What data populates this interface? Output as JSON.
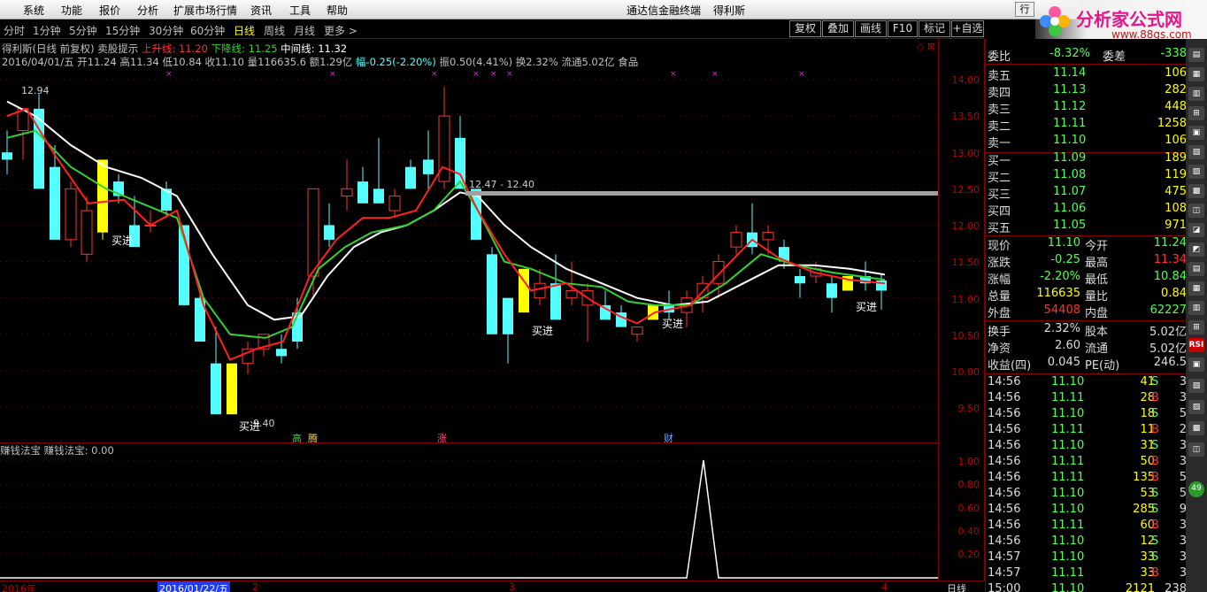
{
  "menu": [
    "系统",
    "功能",
    "报价",
    "分析",
    "扩展市场行情",
    "资讯",
    "工具",
    "帮助"
  ],
  "app_title": "通达信金融终端",
  "stock_name_title": "得利斯",
  "logo": {
    "text": "分析家公式网",
    "url_text": "www.88gs.com"
  },
  "periods": [
    "分时",
    "1分钟",
    "5分钟",
    "15分钟",
    "30分钟",
    "60分钟",
    "日线",
    "周线",
    "月线",
    "更多 >"
  ],
  "active_period": "日线",
  "toolbar_buttons": [
    "复权",
    "叠加",
    "画线",
    "F10",
    "+自选"
  ],
  "chart_header": {
    "title": "得利斯(日线 前复权) 卖股提示",
    "up_line": "上升线: 11.20",
    "down_line": "下降线: 11.25",
    "mid_line": "中间线: 11.32",
    "ohlc": "2016/04/01/五 开11.24 高11.34 低10.84 收11.10 量116635.6 额1.29亿",
    "change": "幅-0.25(-2.20%)",
    "extra": "振0.50(4.41%) 换2.32% 流通5.02亿 食品"
  },
  "price_axis": [
    "14.00",
    "13.50",
    "13.00",
    "12.50",
    "12.00",
    "11.50",
    "11.00",
    "10.50",
    "10.00",
    "9.50"
  ],
  "annotations": {
    "high_label": "12.94",
    "range_label": "12.47 - 12.40",
    "low_label": "9.40",
    "buy_label": "买进",
    "event_tags": [
      "高",
      "腾",
      "涨",
      "财"
    ]
  },
  "indicator": {
    "header": "赚钱法宝 赚钱法宝: 0.00",
    "axis": [
      "1.00",
      "0.80",
      "0.60",
      "0.40",
      "0.20"
    ]
  },
  "dates": [
    "2016年",
    "2016/01/22/五",
    "2",
    "3",
    "4"
  ],
  "bottom_tab": "日线",
  "quote": {
    "ratio": {
      "label": "委比",
      "value": "-8.32%",
      "label2": "委差",
      "value2": "-338"
    },
    "asks": [
      {
        "label": "卖五",
        "price": "11.14",
        "vol": "106"
      },
      {
        "label": "卖四",
        "price": "11.13",
        "vol": "282"
      },
      {
        "label": "卖三",
        "price": "11.12",
        "vol": "448"
      },
      {
        "label": "卖二",
        "price": "11.11",
        "vol": "1258"
      },
      {
        "label": "卖一",
        "price": "11.10",
        "vol": "106"
      }
    ],
    "bids": [
      {
        "label": "买一",
        "price": "11.09",
        "vol": "189"
      },
      {
        "label": "买二",
        "price": "11.08",
        "vol": "119"
      },
      {
        "label": "买三",
        "price": "11.07",
        "vol": "475"
      },
      {
        "label": "买四",
        "price": "11.06",
        "vol": "108"
      },
      {
        "label": "买五",
        "price": "11.05",
        "vol": "971"
      }
    ],
    "stats": [
      {
        "l1": "现价",
        "v1": "11.10",
        "l2": "今开",
        "v2": "11.24"
      },
      {
        "l1": "涨跌",
        "v1": "-0.25",
        "l2": "最高",
        "v2": "11.34"
      },
      {
        "l1": "涨幅",
        "v1": "-2.20%",
        "l2": "最低",
        "v2": "10.84"
      },
      {
        "l1": "总量",
        "v1": "116635",
        "l2": "量比",
        "v2": "0.84"
      },
      {
        "l1": "外盘",
        "v1": "54408",
        "l2": "内盘",
        "v2": "62227"
      }
    ],
    "stats2": [
      {
        "l1": "换手",
        "v1": "2.32%",
        "l2": "股本",
        "v2": "5.02亿"
      },
      {
        "l1": "净资",
        "v1": "2.60",
        "l2": "流通",
        "v2": "5.02亿"
      },
      {
        "l1": "收益(四)",
        "v1": "0.045",
        "l2": "PE(动)",
        "v2": "246.5"
      }
    ],
    "ticks": [
      {
        "time": "14:56",
        "price": "11.10",
        "vol": "41",
        "side": "S",
        "n": "3"
      },
      {
        "time": "14:56",
        "price": "11.11",
        "vol": "28",
        "side": "B",
        "n": "3"
      },
      {
        "time": "14:56",
        "price": "11.10",
        "vol": "18",
        "side": "S",
        "n": "5"
      },
      {
        "time": "14:56",
        "price": "11.11",
        "vol": "11",
        "side": "B",
        "n": "2"
      },
      {
        "time": "14:56",
        "price": "11.10",
        "vol": "31",
        "side": "S",
        "n": "3"
      },
      {
        "time": "14:56",
        "price": "11.11",
        "vol": "50",
        "side": "B",
        "n": "3"
      },
      {
        "time": "14:56",
        "price": "11.11",
        "vol": "135",
        "side": "B",
        "n": "5"
      },
      {
        "time": "14:56",
        "price": "11.10",
        "vol": "53",
        "side": "S",
        "n": "5"
      },
      {
        "time": "14:56",
        "price": "11.10",
        "vol": "285",
        "side": "S",
        "n": "9"
      },
      {
        "time": "14:56",
        "price": "11.11",
        "vol": "60",
        "side": "B",
        "n": "3"
      },
      {
        "time": "14:56",
        "price": "11.10",
        "vol": "12",
        "side": "S",
        "n": "3"
      },
      {
        "time": "14:57",
        "price": "11.10",
        "vol": "33",
        "side": "S",
        "n": "3"
      },
      {
        "time": "14:57",
        "price": "11.11",
        "vol": "33",
        "side": "B",
        "n": "3"
      },
      {
        "time": "15:00",
        "price": "11.10",
        "vol": "2121",
        "side": "",
        "n": "238"
      }
    ]
  },
  "colors": {
    "up": "#ff3232",
    "down": "#54ffff",
    "buy_bar": "#ffff00",
    "ma_white": "#ffffff",
    "ma_red": "#ff2020",
    "ma_green": "#32d232",
    "grid": "#800000"
  }
}
